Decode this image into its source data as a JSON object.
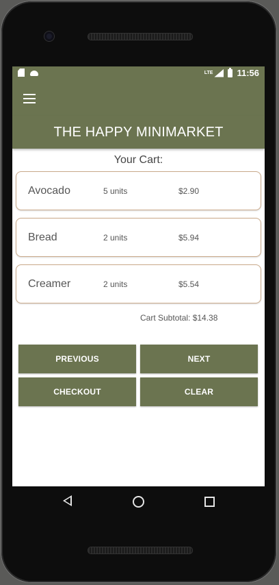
{
  "status_bar": {
    "time": "11:56",
    "network": "LTE",
    "icons": [
      "sd-card-icon",
      "android-icon",
      "signal-icon",
      "battery-icon"
    ]
  },
  "app_bar": {
    "menu_icon": "hamburger-menu-icon"
  },
  "banner": {
    "title": "THE HAPPY MINIMARKET"
  },
  "cart": {
    "title": "Your Cart:",
    "items": [
      {
        "name": "Avocado",
        "quantity": "5 units",
        "price": "$2.90"
      },
      {
        "name": "Bread",
        "quantity": "2 units",
        "price": "$5.94"
      },
      {
        "name": "Creamer",
        "quantity": "2 units",
        "price": "$5.54"
      }
    ],
    "subtotal": "Cart Subtotal: $14.38"
  },
  "buttons": {
    "previous": "PREVIOUS",
    "next": "NEXT",
    "checkout": "CHECKOUT",
    "clear": "CLEAR"
  },
  "colors": {
    "primary": "#6b7450",
    "card_border": "#c9a98a"
  },
  "nav_bar": {
    "icons": [
      "back-icon",
      "home-icon",
      "recents-icon"
    ]
  }
}
